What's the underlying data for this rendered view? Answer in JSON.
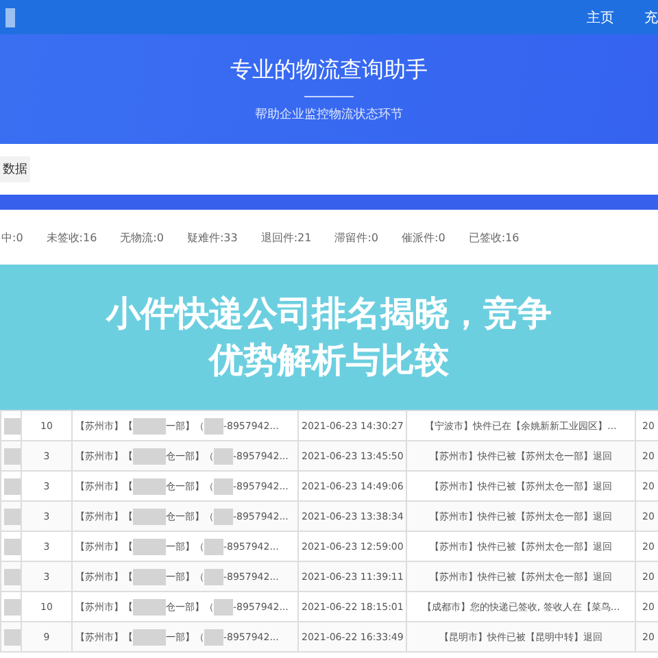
{
  "nav": {
    "links": [
      "主页",
      "充"
    ]
  },
  "banner": {
    "title": "专业的物流查询助手",
    "subtitle": "帮助企业监控物流状态环节"
  },
  "tab": {
    "label": "数据"
  },
  "stats": [
    "中:0",
    "未签收:16",
    "无物流:0",
    "疑难件:33",
    "退回件:21",
    "滞留件:0",
    "催派件:0",
    "已签收:16"
  ],
  "table": {
    "rows": [
      {
        "count": "10",
        "first": [
          "【苏州市】【",
          "一部】（",
          "-8957942..."
        ],
        "time": "2021-06-23 14:30:27",
        "latest": "【宁波市】快件已在【余姚新新工业园区】...",
        "cut": "20"
      },
      {
        "count": "3",
        "first": [
          "【苏州市】【",
          "仓一部】（",
          "-8957942..."
        ],
        "time": "2021-06-23 13:45:50",
        "latest": "【苏州市】快件已被【苏州太仓一部】退回",
        "cut": "20"
      },
      {
        "count": "3",
        "first": [
          "【苏州市】【",
          "仓一部】（",
          "-8957942..."
        ],
        "time": "2021-06-23 14:49:06",
        "latest": "【苏州市】快件已被【苏州太仓一部】退回",
        "cut": "20"
      },
      {
        "count": "3",
        "first": [
          "【苏州市】【",
          "仓一部】（",
          "-8957942..."
        ],
        "time": "2021-06-23 13:38:34",
        "latest": "【苏州市】快件已被【苏州太仓一部】退回",
        "cut": "20"
      },
      {
        "count": "3",
        "first": [
          "【苏州市】【",
          "一部】（",
          "-8957942..."
        ],
        "time": "2021-06-23 12:59:00",
        "latest": "【苏州市】快件已被【苏州太仓一部】退回",
        "cut": "20"
      },
      {
        "count": "3",
        "first": [
          "【苏州市】【",
          "一部】（",
          "-8957942..."
        ],
        "time": "2021-06-23 11:39:11",
        "latest": "【苏州市】快件已被【苏州太仓一部】退回",
        "cut": "20"
      },
      {
        "count": "10",
        "first": [
          "【苏州市】【",
          "仓一部】（",
          "-8957942..."
        ],
        "time": "2021-06-22 18:15:01",
        "latest": "【成都市】您的快递已签收, 签收人在【菜鸟...",
        "cut": "20"
      },
      {
        "count": "9",
        "first": [
          "【苏州市】【",
          "一部】（",
          "-8957942..."
        ],
        "time": "2021-06-22 16:33:49",
        "latest": "【昆明市】快件已被【昆明中转】退回",
        "cut": "20"
      }
    ]
  },
  "overlay": {
    "title_lines": [
      "小件快递公司排名揭晓，竞争",
      "优势解析与比较"
    ]
  }
}
